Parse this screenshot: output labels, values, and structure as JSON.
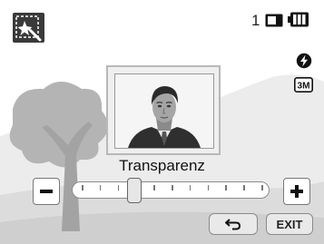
{
  "status": {
    "shots_remaining": "1",
    "battery_icon": "battery-full-icon",
    "card_icon": "memory-card-icon",
    "flash_icon": "flash-auto-icon",
    "size_icon": "resolution-3m-icon",
    "size_text": "3M"
  },
  "mode": {
    "icon": "magic-frame-icon"
  },
  "photo": {
    "subject_icon": "portrait-icon"
  },
  "adjust": {
    "label": "Transparenz",
    "minus_label": "−",
    "plus_label": "+",
    "value_fraction": 0.3
  },
  "footer": {
    "back_icon": "back-arrow-icon",
    "exit_label": "EXIT"
  },
  "colors": {
    "tree": "#b0b0b0",
    "tree_trunk": "#9a9a9a",
    "hills_light": "#e2e2e2",
    "ground": "#d8d8d8"
  }
}
